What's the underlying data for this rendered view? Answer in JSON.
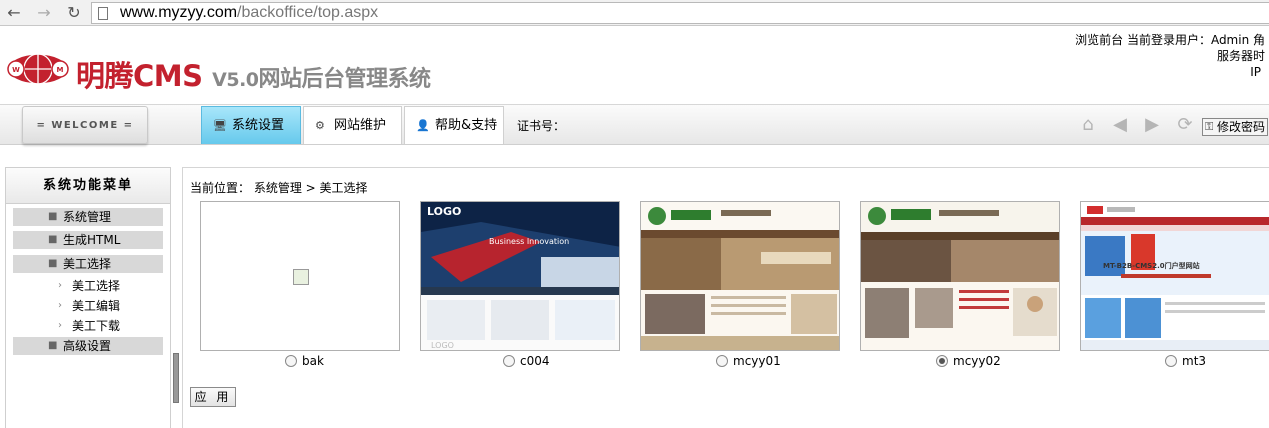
{
  "browser": {
    "url_host": "www.myzyy.com",
    "url_path": "/backoffice/top.aspx",
    "back_icon": "arrow-left-icon",
    "forward_icon": "arrow-right-icon",
    "reload_icon": "reload-icon"
  },
  "header": {
    "brand": "明腾CMS",
    "version": "V5.0",
    "system_name": "网站后台管理系统",
    "top_links": "浏览前台 当前登录用户：Admin 角",
    "server_time": "服务器时",
    "ip": "IP"
  },
  "toolbar": {
    "welcome": "= WELCOME =",
    "tabs": [
      {
        "label": "系统设置",
        "icon": "monitor-icon"
      },
      {
        "label": "网站维护",
        "icon": "gear-icon"
      },
      {
        "label": "帮助&支持",
        "icon": "user-icon"
      }
    ],
    "cert_label": "证书号：",
    "password_button": "修改密码"
  },
  "sidebar": {
    "title": "系统功能菜单",
    "items": [
      "系统管理",
      "生成HTML",
      "美工选择"
    ],
    "sub_items": [
      "美工选择",
      "美工编辑",
      "美工下载"
    ],
    "last_item": "高级设置"
  },
  "main": {
    "breadcrumb": "当前位置： 系统管理 > 美工选择",
    "templates": [
      {
        "name": "bak",
        "checked": false
      },
      {
        "name": "c004",
        "checked": false
      },
      {
        "name": "mcyy01",
        "checked": false
      },
      {
        "name": "mcyy02",
        "checked": true
      },
      {
        "name": "mt3",
        "checked": false
      }
    ],
    "thumb_text": {
      "logo": "LOGO",
      "banner": "Business Innovation",
      "mt_banner": "MT-B2B-CMS2.0门户型网站"
    },
    "apply_button": "应 用"
  },
  "colors": {
    "brand_red": "#c3212e",
    "active_tab": "#66c9ec"
  }
}
